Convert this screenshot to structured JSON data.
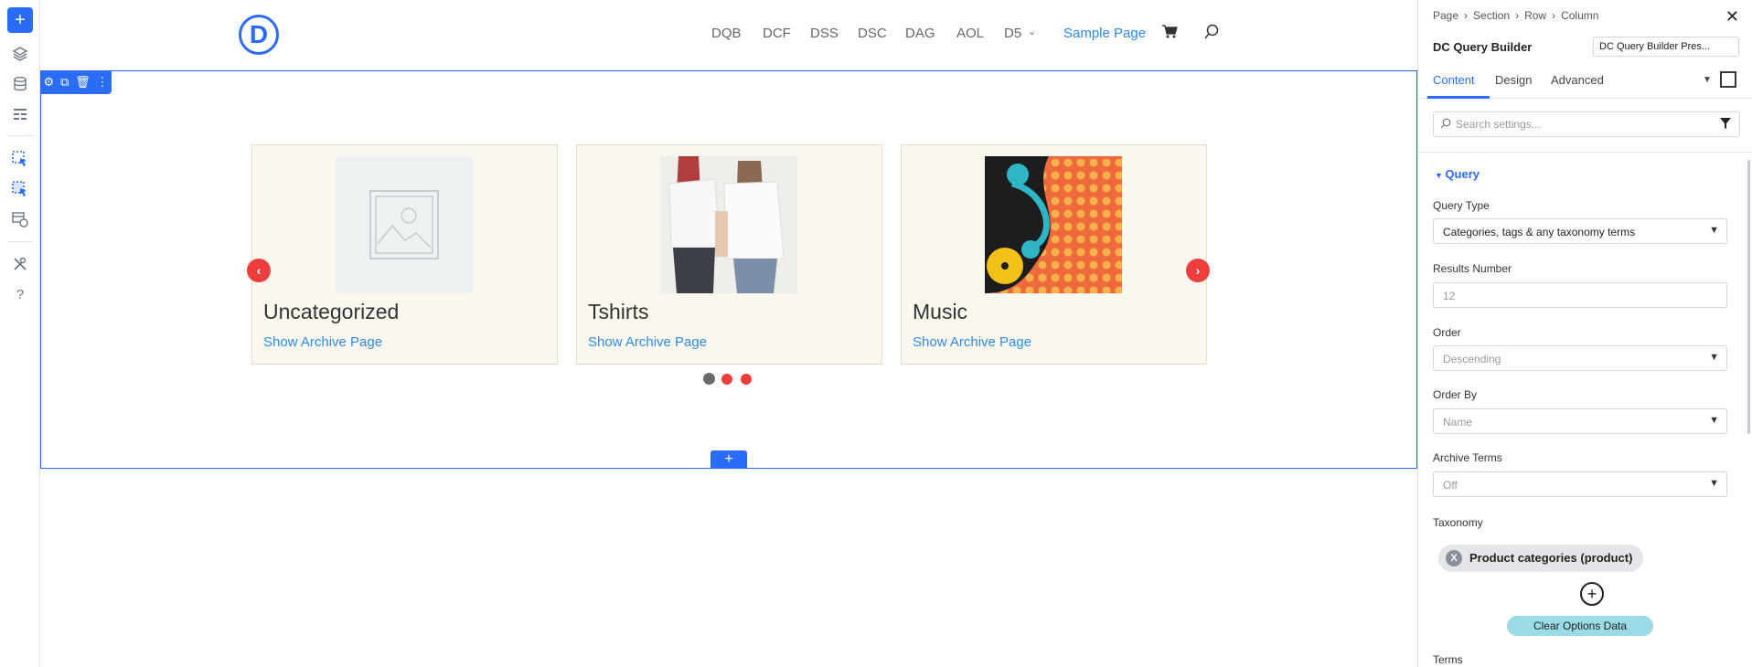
{
  "left_toolbar": {
    "items": [
      "add-icon",
      "layers-icon",
      "database-icon",
      "layout-icon",
      "select-icon",
      "multi-select-icon",
      "portability-icon",
      "tools-icon",
      "help-icon"
    ],
    "help_label": "?"
  },
  "header": {
    "logo_letter": "D",
    "nav": [
      "DQB",
      "DCF",
      "DSS",
      "DSC",
      "DAG",
      "AOL",
      "D5"
    ],
    "nav_active": "Sample Page"
  },
  "carousel": {
    "cards": [
      {
        "title": "Uncategorized",
        "link": "Show Archive Page"
      },
      {
        "title": "Tshirts",
        "link": "Show Archive Page"
      },
      {
        "title": "Music",
        "link": "Show Archive Page"
      }
    ],
    "add_label": "+"
  },
  "panel": {
    "breadcrumb": [
      "Page",
      "Section",
      "Row",
      "Column"
    ],
    "module_title": "DC Query Builder",
    "preset": "DC Query Builder Pres...",
    "tabs": [
      "Content",
      "Design",
      "Advanced"
    ],
    "search_placeholder": "Search settings...",
    "group_title": "Query",
    "fields": {
      "query_type_label": "Query Type",
      "query_type_value": "Categories, tags & any taxonomy terms",
      "results_number_label": "Results Number",
      "results_number_value": "12",
      "order_label": "Order",
      "order_value": "Descending",
      "order_by_label": "Order By",
      "order_by_value": "Name",
      "archive_terms_label": "Archive Terms",
      "archive_terms_value": "Off",
      "taxonomy_label": "Taxonomy",
      "taxonomy_chip": "Product categories (product)",
      "clear_button": "Clear Options Data",
      "terms_label": "Terms"
    }
  },
  "colors": {
    "accent": "#2b6cf6",
    "arrow": "#ee3d3d",
    "link": "#2e8ae6",
    "card_bg": "#faf8ee"
  }
}
